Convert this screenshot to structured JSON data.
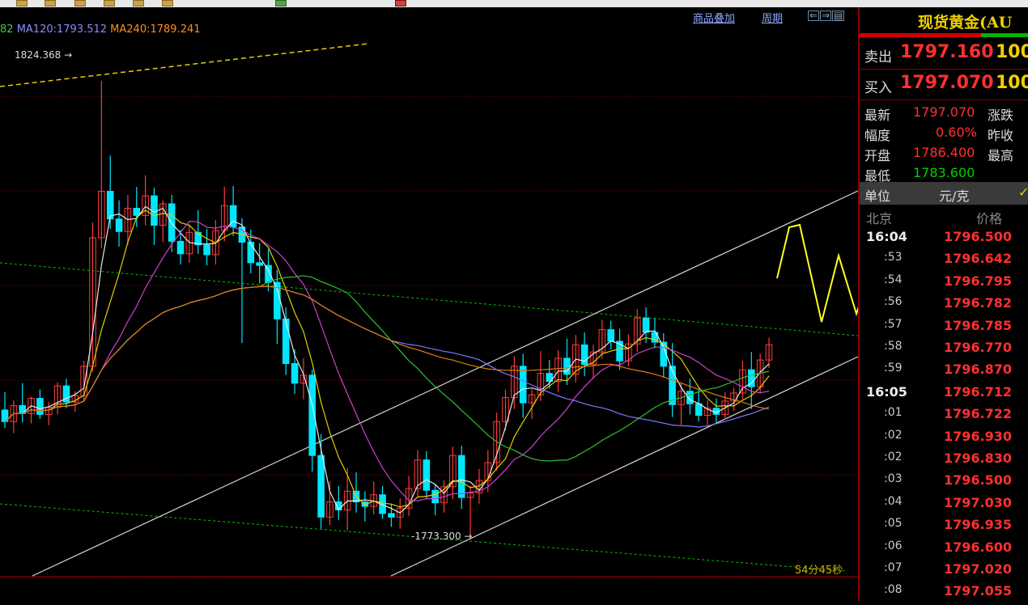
{
  "toolbar": {
    "icons": [
      "toolbar-button-1",
      "toolbar-button-2",
      "toolbar-button-3",
      "toolbar-button-4",
      "toolbar-button-5",
      "toolbar-button-6",
      "toolbar-button-7",
      "toolbar-button-8"
    ]
  },
  "header": {
    "ma_text": [
      {
        "text": "82",
        "color": "#40d040"
      },
      {
        "text": "MA120:1793.512",
        "color": "#8a8aff"
      },
      {
        "text": "MA240:1789.241",
        "color": "#ff8c1a"
      }
    ],
    "overlay_link": "商品叠加",
    "period_link": "周期"
  },
  "chart_data": {
    "type": "candlestick",
    "annotations": {
      "high_label": "1824.368",
      "low_label": "1773.300"
    },
    "timer": "54分45秒",
    "ylim": [
      1770,
      1828
    ],
    "series": [
      {
        "name": "MA120",
        "value": 1793.512,
        "color": "#8a8aff"
      },
      {
        "name": "MA240",
        "value": 1789.241,
        "color": "#ff8c1a"
      }
    ],
    "candles": [
      [
        1787.5,
        1789.5,
        1785.5,
        1786.2
      ],
      [
        1786.2,
        1788.6,
        1784.9,
        1788.0
      ],
      [
        1788.0,
        1790.5,
        1786.1,
        1787.1
      ],
      [
        1787.1,
        1789.0,
        1786.0,
        1788.8
      ],
      [
        1788.8,
        1789.8,
        1786.5,
        1787.0
      ],
      [
        1787.0,
        1788.4,
        1785.8,
        1787.8
      ],
      [
        1787.8,
        1790.6,
        1787.0,
        1790.2
      ],
      [
        1790.2,
        1791.0,
        1787.7,
        1788.4
      ],
      [
        1788.4,
        1789.6,
        1787.3,
        1789.1
      ],
      [
        1789.1,
        1793.0,
        1788.5,
        1792.4
      ],
      [
        1792.4,
        1808.5,
        1791.8,
        1806.8
      ],
      [
        1806.8,
        1824.4,
        1805.6,
        1812.0
      ],
      [
        1812.0,
        1816.0,
        1807.8,
        1808.9
      ],
      [
        1808.9,
        1811.0,
        1805.8,
        1807.5
      ],
      [
        1807.5,
        1811.6,
        1806.0,
        1810.1
      ],
      [
        1810.1,
        1812.5,
        1808.0,
        1809.3
      ],
      [
        1809.3,
        1813.8,
        1808.2,
        1811.5
      ],
      [
        1811.5,
        1812.4,
        1806.0,
        1808.2
      ],
      [
        1808.2,
        1811.0,
        1806.3,
        1810.6
      ],
      [
        1810.6,
        1811.6,
        1805.2,
        1806.4
      ],
      [
        1806.4,
        1807.7,
        1803.8,
        1805.0
      ],
      [
        1805.0,
        1808.3,
        1804.0,
        1807.4
      ],
      [
        1807.4,
        1809.9,
        1805.0,
        1806.0
      ],
      [
        1806.0,
        1807.8,
        1803.7,
        1804.9
      ],
      [
        1804.9,
        1808.8,
        1803.8,
        1807.6
      ],
      [
        1807.6,
        1812.5,
        1806.4,
        1810.4
      ],
      [
        1810.4,
        1812.6,
        1807.0,
        1808.0
      ],
      [
        1808.0,
        1809.0,
        1795.0,
        1806.3
      ],
      [
        1806.3,
        1807.7,
        1802.8,
        1804.0
      ],
      [
        1804.0,
        1806.2,
        1801.7,
        1803.7
      ],
      [
        1803.7,
        1805.5,
        1800.8,
        1801.8
      ],
      [
        1801.8,
        1803.2,
        1794.9,
        1797.7
      ],
      [
        1797.7,
        1799.0,
        1791.4,
        1792.7
      ],
      [
        1792.7,
        1794.3,
        1789.3,
        1790.5
      ],
      [
        1790.5,
        1793.3,
        1788.7,
        1791.4
      ],
      [
        1791.4,
        1792.0,
        1780.6,
        1782.4
      ],
      [
        1782.4,
        1784.8,
        1774.2,
        1775.5
      ],
      [
        1775.5,
        1779.5,
        1774.6,
        1777.2
      ],
      [
        1777.2,
        1779.0,
        1775.2,
        1776.3
      ],
      [
        1776.3,
        1781.0,
        1774.0,
        1778.4
      ],
      [
        1778.4,
        1780.5,
        1776.0,
        1777.2
      ],
      [
        1777.2,
        1778.4,
        1775.0,
        1776.7
      ],
      [
        1776.7,
        1779.5,
        1775.8,
        1778.0
      ],
      [
        1778.0,
        1779.0,
        1775.3,
        1775.9
      ],
      [
        1775.9,
        1777.0,
        1774.4,
        1775.5
      ],
      [
        1775.5,
        1777.6,
        1774.2,
        1776.5
      ],
      [
        1776.5,
        1780.1,
        1775.6,
        1778.7
      ],
      [
        1778.7,
        1783.0,
        1777.7,
        1781.9
      ],
      [
        1781.9,
        1782.9,
        1777.5,
        1778.5
      ],
      [
        1778.5,
        1779.2,
        1775.7,
        1777.1
      ],
      [
        1777.1,
        1779.6,
        1776.0,
        1778.9
      ],
      [
        1778.9,
        1783.4,
        1777.5,
        1782.4
      ],
      [
        1782.4,
        1783.5,
        1776.4,
        1777.7
      ],
      [
        1777.7,
        1779.0,
        1773.3,
        1778.2
      ],
      [
        1778.2,
        1780.9,
        1777.0,
        1779.6
      ],
      [
        1779.6,
        1783.0,
        1778.3,
        1781.6
      ],
      [
        1781.6,
        1787.2,
        1780.7,
        1786.2
      ],
      [
        1786.2,
        1789.8,
        1785.2,
        1788.9
      ],
      [
        1788.9,
        1793.5,
        1787.6,
        1792.4
      ],
      [
        1792.4,
        1793.8,
        1786.6,
        1788.3
      ],
      [
        1788.3,
        1789.8,
        1786.5,
        1789.2
      ],
      [
        1789.2,
        1794.1,
        1788.5,
        1791.6
      ],
      [
        1791.6,
        1793.1,
        1789.9,
        1790.7
      ],
      [
        1790.7,
        1794.2,
        1789.5,
        1793.3
      ],
      [
        1793.3,
        1795.5,
        1790.3,
        1791.5
      ],
      [
        1791.5,
        1795.9,
        1790.6,
        1794.8
      ],
      [
        1794.8,
        1796.2,
        1791.3,
        1792.6
      ],
      [
        1792.6,
        1794.8,
        1791.0,
        1794.0
      ],
      [
        1794.0,
        1797.6,
        1793.3,
        1796.5
      ],
      [
        1796.5,
        1797.5,
        1794.3,
        1795.2
      ],
      [
        1795.2,
        1796.6,
        1792.0,
        1793.0
      ],
      [
        1793.0,
        1796.0,
        1792.4,
        1794.9
      ],
      [
        1794.9,
        1798.8,
        1794.0,
        1797.8
      ],
      [
        1797.8,
        1799.0,
        1795.0,
        1796.2
      ],
      [
        1796.2,
        1797.8,
        1794.4,
        1795.1
      ],
      [
        1795.1,
        1796.1,
        1791.1,
        1792.4
      ],
      [
        1792.4,
        1795.0,
        1786.7,
        1788.1
      ],
      [
        1788.1,
        1790.6,
        1785.8,
        1789.6
      ],
      [
        1789.6,
        1791.0,
        1787.0,
        1788.2
      ],
      [
        1788.2,
        1789.9,
        1786.2,
        1786.9
      ],
      [
        1786.9,
        1788.6,
        1785.6,
        1787.7
      ],
      [
        1787.7,
        1788.8,
        1786.1,
        1787.0
      ],
      [
        1787.0,
        1789.5,
        1786.4,
        1788.5
      ],
      [
        1788.5,
        1790.0,
        1787.4,
        1789.4
      ],
      [
        1789.4,
        1793.0,
        1788.7,
        1792.0
      ],
      [
        1792.0,
        1794.0,
        1787.6,
        1790.1
      ],
      [
        1790.1,
        1793.8,
        1789.3,
        1793.1
      ],
      [
        1793.1,
        1795.6,
        1792.2,
        1794.8
      ]
    ]
  },
  "panel": {
    "title": "现货黄金(AU",
    "sell_label": "卖出",
    "sell_price": "1797.160",
    "sell_vol": "100",
    "buy_label": "买入",
    "buy_price": "1797.070",
    "buy_vol": "100",
    "stats": [
      {
        "k": "最新",
        "v": "1797.070",
        "v_color": "#ff3030",
        "k2": "涨跌"
      },
      {
        "k": "幅度",
        "v": "0.60%",
        "v_color": "#ff3030",
        "k2": "昨收"
      },
      {
        "k": "开盘",
        "v": "1786.400",
        "v_color": "#ff3030",
        "k2": "最高"
      },
      {
        "k": "最低",
        "v": "1783.600",
        "v_color": "#00d000",
        "k2": ""
      }
    ],
    "unit_label": "单位",
    "unit_value": "元/克",
    "unit_check": "✓",
    "tick_header_time": "北京",
    "tick_header_price": "价格",
    "ticks": [
      {
        "t": "16:04",
        "major": true,
        "p": "1796.500"
      },
      {
        "t": ":53",
        "major": false,
        "p": "1796.642"
      },
      {
        "t": ":54",
        "major": false,
        "p": "1796.795"
      },
      {
        "t": ":56",
        "major": false,
        "p": "1796.782"
      },
      {
        "t": ":57",
        "major": false,
        "p": "1796.785"
      },
      {
        "t": ":58",
        "major": false,
        "p": "1796.770"
      },
      {
        "t": ":59",
        "major": false,
        "p": "1796.870"
      },
      {
        "t": "16:05",
        "major": true,
        "p": "1796.712"
      },
      {
        "t": ":01",
        "major": false,
        "p": "1796.722"
      },
      {
        "t": ":02",
        "major": false,
        "p": "1796.930"
      },
      {
        "t": ":02",
        "major": false,
        "p": "1796.830"
      },
      {
        "t": ":03",
        "major": false,
        "p": "1796.500"
      },
      {
        "t": ":04",
        "major": false,
        "p": "1797.030"
      },
      {
        "t": ":05",
        "major": false,
        "p": "1796.935"
      },
      {
        "t": ":06",
        "major": false,
        "p": "1796.600"
      },
      {
        "t": ":07",
        "major": false,
        "p": "1797.020"
      },
      {
        "t": ":08",
        "major": false,
        "p": "1797.055"
      }
    ]
  }
}
